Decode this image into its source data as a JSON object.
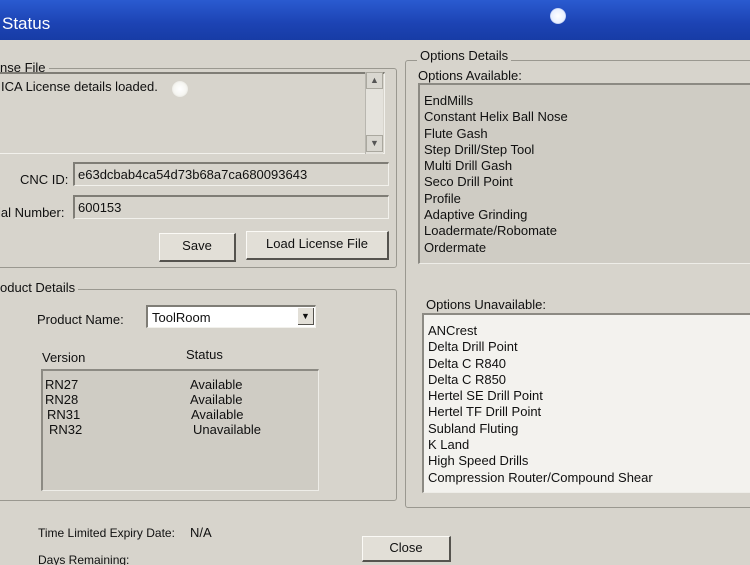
{
  "window": {
    "title": "Status"
  },
  "license": {
    "group_label": "nse File",
    "message": "ICA License details loaded.",
    "cnc_id_label": "CNC ID:",
    "cnc_id_value": "e63dcbab4ca54d73b68a7ca680093643",
    "serial_label": "ial Number:",
    "serial_value": "600153",
    "save_label": "Save",
    "load_label": "Load License File"
  },
  "product": {
    "group_label": "oduct Details",
    "name_label": "Product Name:",
    "name_value": "ToolRoom",
    "version_header": "Version",
    "status_header": "Status",
    "rows": [
      {
        "version": "RN27",
        "status": "Available"
      },
      {
        "version": "RN28",
        "status": "Available"
      },
      {
        "version": "RN31",
        "status": "Available"
      },
      {
        "version": "RN32",
        "status": "Unavailable"
      }
    ]
  },
  "options": {
    "group_label": "Options Details",
    "available_label": "Options Available:",
    "available": [
      "EndMills",
      "Constant Helix Ball Nose",
      "Flute Gash",
      "Step Drill/Step Tool",
      "Multi Drill Gash",
      "Seco Drill Point",
      "Profile",
      "Adaptive Grinding",
      "Loadermate/Robomate",
      "Ordermate"
    ],
    "unavailable_label": "Options Unavailable:",
    "unavailable": [
      "ANCrest",
      "Delta Drill Point",
      "Delta C R840",
      "Delta C R850",
      "Hertel SE Drill Point",
      "Hertel TF Drill Point",
      "Subland Fluting",
      "K Land",
      "High Speed Drills",
      "Compression Router/Compound Shear"
    ]
  },
  "footer": {
    "expiry_label": "Time Limited Expiry Date:",
    "expiry_value": "N/A",
    "days_label": "Days Remaining:",
    "close_label": "Close"
  },
  "icons": {
    "scroll_up": "triangle-up",
    "scroll_down": "triangle-down",
    "dropdown": "triangle-down"
  }
}
